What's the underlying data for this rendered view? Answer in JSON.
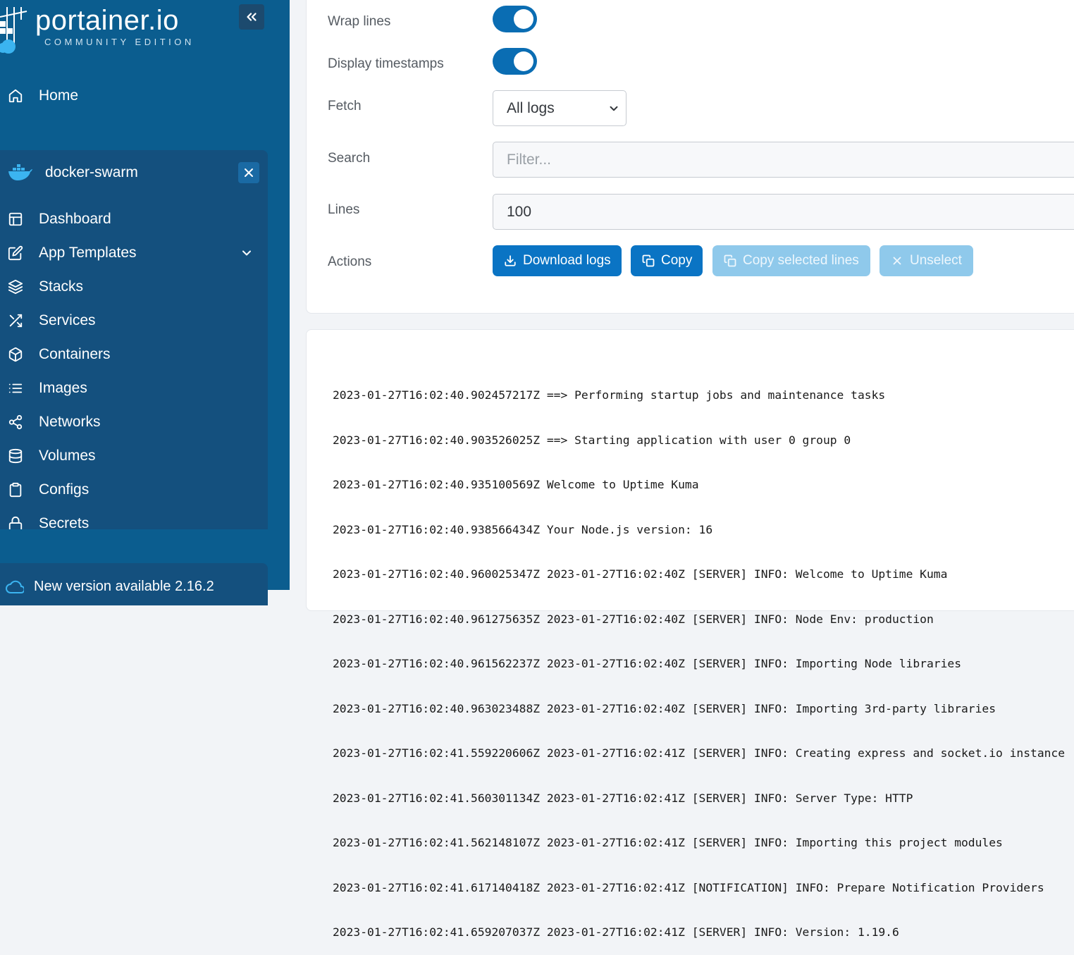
{
  "brand": {
    "name": "portainer.io",
    "edition": "COMMUNITY EDITION"
  },
  "sidebar": {
    "home_label": "Home",
    "environment": {
      "name": "docker-swarm",
      "items": [
        {
          "label": "Dashboard",
          "icon": "layout-icon"
        },
        {
          "label": "App Templates",
          "icon": "edit-icon",
          "expandable": true
        },
        {
          "label": "Stacks",
          "icon": "layers-icon"
        },
        {
          "label": "Services",
          "icon": "shuffle-icon"
        },
        {
          "label": "Containers",
          "icon": "box-icon"
        },
        {
          "label": "Images",
          "icon": "list-icon"
        },
        {
          "label": "Networks",
          "icon": "share-icon"
        },
        {
          "label": "Volumes",
          "icon": "database-icon"
        },
        {
          "label": "Configs",
          "icon": "clipboard-icon"
        },
        {
          "label": "Secrets",
          "icon": "lock-icon"
        }
      ]
    },
    "update_notice": "New version available 2.16.2"
  },
  "log_settings": {
    "wrap_lines_label": "Wrap lines",
    "wrap_lines_on": true,
    "timestamps_label": "Display timestamps",
    "timestamps_on": true,
    "fetch_label": "Fetch",
    "fetch_value": "All logs",
    "search_label": "Search",
    "search_placeholder": "Filter...",
    "lines_label": "Lines",
    "lines_value": "100",
    "actions_label": "Actions",
    "buttons": {
      "download": "Download logs",
      "copy": "Copy",
      "copy_selected": "Copy selected lines",
      "unselect": "Unselect"
    }
  },
  "colors": {
    "sidebar_bg": "#0b5d8f",
    "primary": "#0a74c4",
    "disabled": "#8fc9eb"
  },
  "logs": [
    "2023-01-27T16:02:40.902457217Z ==> Performing startup jobs and maintenance tasks",
    "2023-01-27T16:02:40.903526025Z ==> Starting application with user 0 group 0",
    "2023-01-27T16:02:40.935100569Z Welcome to Uptime Kuma",
    "2023-01-27T16:02:40.938566434Z Your Node.js version: 16",
    "2023-01-27T16:02:40.960025347Z 2023-01-27T16:02:40Z [SERVER] INFO: Welcome to Uptime Kuma",
    "2023-01-27T16:02:40.961275635Z 2023-01-27T16:02:40Z [SERVER] INFO: Node Env: production",
    "2023-01-27T16:02:40.961562237Z 2023-01-27T16:02:40Z [SERVER] INFO: Importing Node libraries",
    "2023-01-27T16:02:40.963023488Z 2023-01-27T16:02:40Z [SERVER] INFO: Importing 3rd-party libraries",
    "2023-01-27T16:02:41.559220606Z 2023-01-27T16:02:41Z [SERVER] INFO: Creating express and socket.io instance",
    "2023-01-27T16:02:41.560301134Z 2023-01-27T16:02:41Z [SERVER] INFO: Server Type: HTTP",
    "2023-01-27T16:02:41.562148107Z 2023-01-27T16:02:41Z [SERVER] INFO: Importing this project modules",
    "2023-01-27T16:02:41.617140418Z 2023-01-27T16:02:41Z [NOTIFICATION] INFO: Prepare Notification Providers",
    "2023-01-27T16:02:41.659207037Z 2023-01-27T16:02:41Z [SERVER] INFO: Version: 1.19.6"
  ]
}
